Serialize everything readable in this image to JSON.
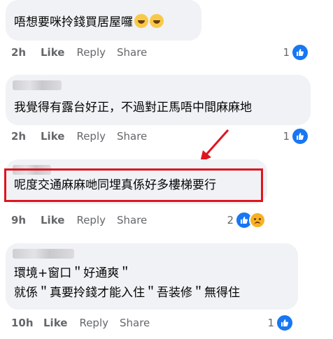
{
  "comments": [
    {
      "text": "唔想要咪拎錢買居屋囉",
      "time": "2h",
      "like": "Like",
      "reply": "Reply",
      "share": "Share",
      "count": "1"
    },
    {
      "text": "我覺得有露台好正，不過對正馬唔中間麻麻地",
      "time": "2h",
      "like": "Like",
      "reply": "Reply",
      "share": "Share",
      "count": "1"
    },
    {
      "text": "呢度交通麻麻哋同埋真係好多樓梯要行",
      "time": "9h",
      "like": "Like",
      "reply": "Reply",
      "share": "Share",
      "count": "2"
    },
    {
      "line1": "環境+窗口＂好通爽＂",
      "line2": "就係＂真要拎錢才能入住＂吾装修＂無得住",
      "time": "10h",
      "like": "Like",
      "reply": "Reply",
      "share": "Share",
      "count": "1"
    }
  ],
  "colors": {
    "like_blue": "#1877f2",
    "highlight_red": "#e0141e",
    "arrow_red": "#e0141e",
    "bubble_bg": "#f0f2f5"
  },
  "icons": [
    "like-reaction-icon",
    "sad-reaction-icon",
    "laughing-emoji-icon",
    "annotation-arrow"
  ]
}
